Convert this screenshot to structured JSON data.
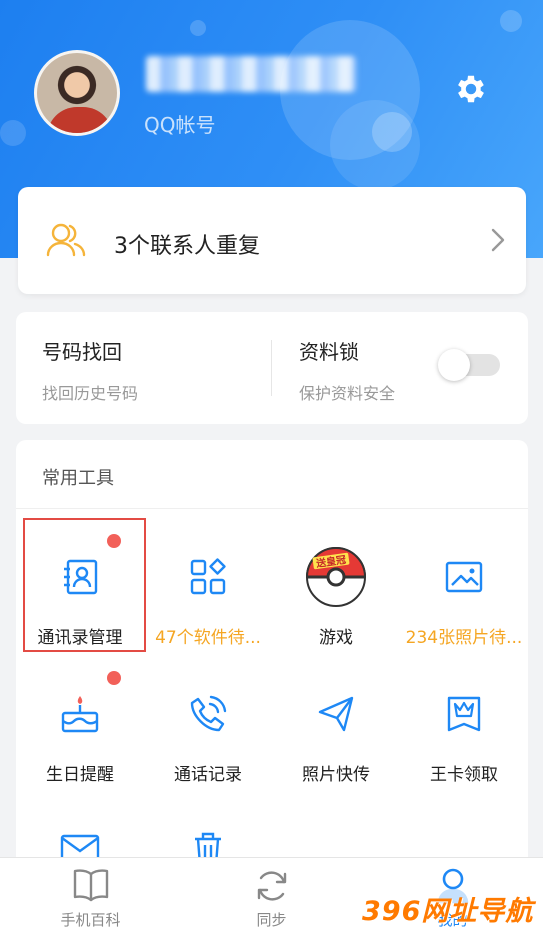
{
  "header": {
    "account_label": "QQ帐号",
    "accent": "#1e88f5"
  },
  "duplicates": {
    "text": "3个联系人重复",
    "icon": "contacts-group-icon"
  },
  "recover": {
    "title": "号码找回",
    "subtitle": "找回历史号码"
  },
  "lock": {
    "title": "资料锁",
    "subtitle": "保护资料安全",
    "enabled": false
  },
  "tools": {
    "section_title": "常用工具",
    "items": [
      {
        "label": "通讯录管理",
        "icon": "contact-card-icon",
        "badge": true,
        "highlight": true
      },
      {
        "label": "47个软件待...",
        "icon": "apps-grid-icon",
        "badge": false
      },
      {
        "label": "游戏",
        "icon": "pokeball-game-icon",
        "icon_text": "送皇冠",
        "badge": false
      },
      {
        "label": "234张照片待...",
        "icon": "photo-icon",
        "badge": false
      },
      {
        "label": "生日提醒",
        "icon": "birthday-cake-icon",
        "badge": true
      },
      {
        "label": "通话记录",
        "icon": "phone-call-icon",
        "badge": false
      },
      {
        "label": "照片快传",
        "icon": "paper-plane-icon",
        "badge": false
      },
      {
        "label": "王卡领取",
        "icon": "king-card-icon",
        "badge": false
      },
      {
        "label": "",
        "icon": "mail-icon",
        "badge": false
      },
      {
        "label": "",
        "icon": "trash-icon",
        "badge": false
      }
    ]
  },
  "nav": {
    "items": [
      {
        "label": "手机百科",
        "icon": "book-icon",
        "active": false
      },
      {
        "label": "同步",
        "icon": "sync-icon",
        "active": false
      },
      {
        "label": "我的",
        "icon": "profile-icon",
        "active": true
      }
    ]
  },
  "watermark": "396网址导航"
}
